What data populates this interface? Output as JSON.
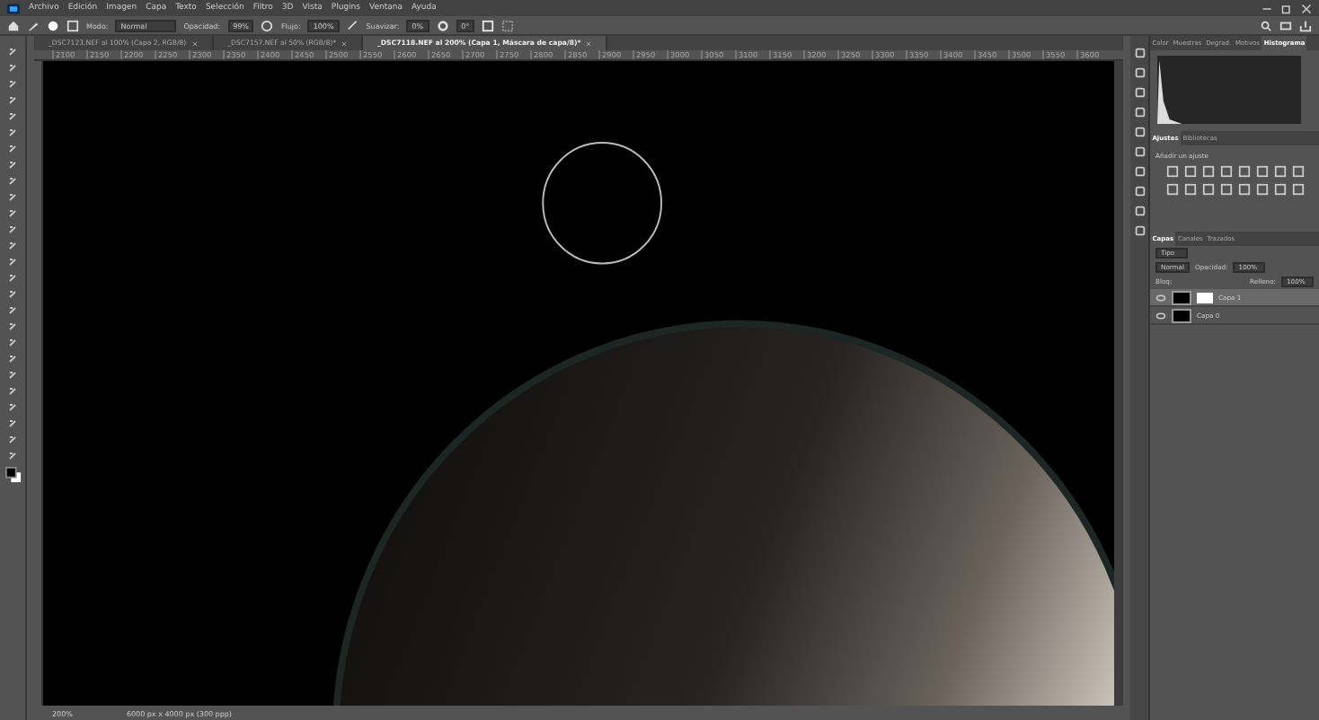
{
  "menu": [
    "Archivo",
    "Edición",
    "Imagen",
    "Capa",
    "Texto",
    "Selección",
    "Filtro",
    "3D",
    "Vista",
    "Plugins",
    "Ventana",
    "Ayuda"
  ],
  "options": {
    "mode_label": "Modo:",
    "mode": "Normal",
    "opacity_label": "Opacidad:",
    "opacity": "99%",
    "flow_label": "Flujo:",
    "flow": "100%",
    "smooth_label": "Suavizar:",
    "smooth": "0%",
    "angle": "0°"
  },
  "tabs": [
    {
      "label": "_DSC7123.NEF al 100% (Capa 2, RGB/8)",
      "selected": false
    },
    {
      "label": "_DSC7157.NEF al 50% (RGB/8)*",
      "selected": false
    },
    {
      "label": "_DSC7118.NEF al 200% (Capa 1, Máscara de capa/8)*",
      "selected": true
    }
  ],
  "ruler": [
    "2100",
    "2150",
    "2200",
    "2250",
    "2300",
    "2350",
    "2400",
    "2450",
    "2500",
    "2550",
    "2600",
    "2650",
    "2700",
    "2750",
    "2800",
    "2850",
    "2900",
    "2950",
    "3000",
    "3050",
    "3100",
    "3150",
    "3200",
    "3250",
    "3300",
    "3350",
    "3400",
    "3450",
    "3500",
    "3550",
    "3600"
  ],
  "panels": {
    "top_tabs": [
      {
        "label": "Color",
        "selected": false
      },
      {
        "label": "Muestras",
        "selected": false
      },
      {
        "label": "Degrad.",
        "selected": false
      },
      {
        "label": "Motivos",
        "selected": false
      },
      {
        "label": "Histograma",
        "selected": true
      }
    ],
    "adjust_tabs": [
      {
        "label": "Ajustes",
        "selected": true
      },
      {
        "label": "Bibliotecas",
        "selected": false
      }
    ],
    "adjust_hint": "Añadir un ajuste",
    "layer_tabs": [
      {
        "label": "Capas",
        "selected": true
      },
      {
        "label": "Canales",
        "selected": false
      },
      {
        "label": "Trazados",
        "selected": false
      }
    ],
    "filter": "Tipo",
    "blend": "Normal",
    "opacity_label": "Opacidad:",
    "opacity": "100%",
    "lock_label": "Bloq:",
    "fill_label": "Relleno:",
    "fill": "100%",
    "layers": [
      {
        "name": "Capa 1",
        "selected": true,
        "mask": true
      },
      {
        "name": "Capa 0",
        "selected": false,
        "mask": false
      }
    ]
  },
  "status": {
    "zoom": "200%",
    "info": "6000 px x 4000 px (300 ppp)"
  }
}
